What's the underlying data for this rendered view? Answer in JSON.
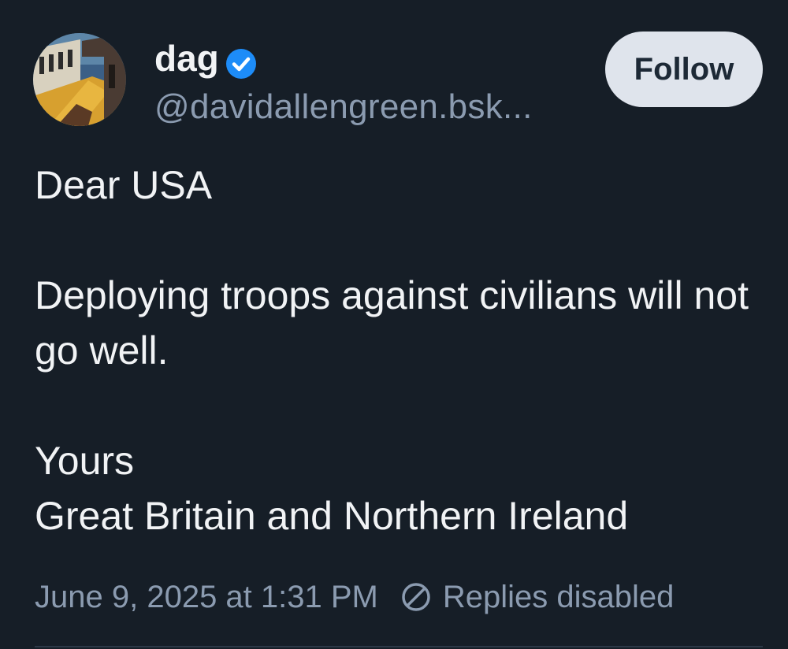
{
  "author": {
    "name": "dag",
    "handle": "@davidallengreen.bsk...",
    "verified": true,
    "avatar_icon": "avatar-painting-icon"
  },
  "actions": {
    "follow_label": "Follow"
  },
  "post": {
    "lines": [
      "Dear USA",
      "Deploying troops against civilians will not go well.",
      "Yours",
      "Great Britain and Northern Ireland"
    ]
  },
  "meta": {
    "timestamp": "June 9, 2025 at 1:31 PM",
    "replies_status": "Replies disabled"
  },
  "colors": {
    "background": "#161e27",
    "text": "#f1f3f5",
    "muted": "#8b9bb0",
    "verified": "#1d8cf8",
    "button_bg": "#dfe4ec"
  }
}
